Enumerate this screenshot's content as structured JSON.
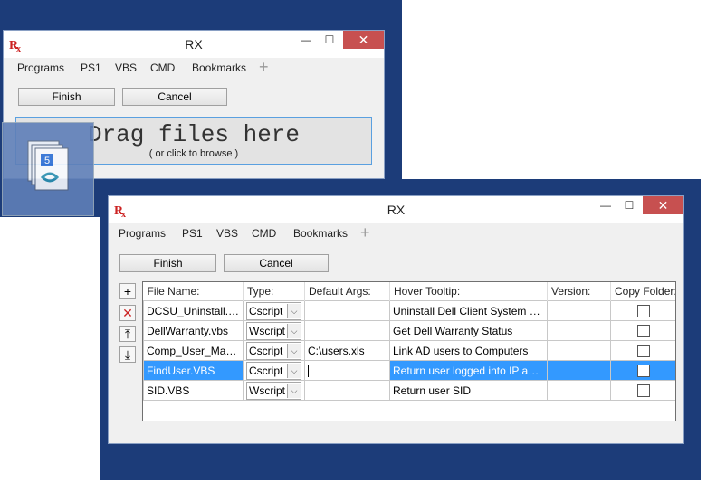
{
  "app": {
    "title": "RX",
    "logo": "Rx"
  },
  "titlebar": {
    "minimize": "—",
    "maximize": "☐",
    "close": "✕"
  },
  "menu": {
    "items": [
      "Programs",
      "PS1",
      "VBS",
      "CMD",
      "Bookmarks"
    ],
    "add": "+"
  },
  "buttons": {
    "finish": "Finish",
    "cancel": "Cancel"
  },
  "dropzone": {
    "title": "Drag files here",
    "subtitle": "( or click to browse )"
  },
  "drag_icon": {
    "badge": "5"
  },
  "sidebar": {
    "add": "+",
    "remove": "✕",
    "move_top": "⤒",
    "move_down": "⤓"
  },
  "table": {
    "headers": [
      "File Name:",
      "Type:",
      "Default Args:",
      "Hover Tooltip:",
      "Version:",
      "Copy Folder:"
    ],
    "rows": [
      {
        "file": "DCSU_Uninstall.vbs",
        "type": "Cscript",
        "args": "",
        "tooltip": "Uninstall Dell Client System Update",
        "version": ""
      },
      {
        "file": "DellWarranty.vbs",
        "type": "Wscript",
        "args": "",
        "tooltip": "Get Dell Warranty Status",
        "version": ""
      },
      {
        "file": "Comp_User_Map.v...",
        "type": "Cscript",
        "args": "C:\\users.xls",
        "tooltip": "Link AD users to Computers",
        "version": ""
      },
      {
        "file": "FindUser.VBS",
        "type": "Cscript",
        "args": "",
        "tooltip": "Return user logged into IP address",
        "version": ""
      },
      {
        "file": "SID.VBS",
        "type": "Wscript",
        "args": "",
        "tooltip": "Return user SID",
        "version": ""
      }
    ]
  },
  "colors": {
    "desktop": "#1c3c79",
    "selection": "#3399ff",
    "close": "#c75050",
    "logo": "#cc2222"
  }
}
